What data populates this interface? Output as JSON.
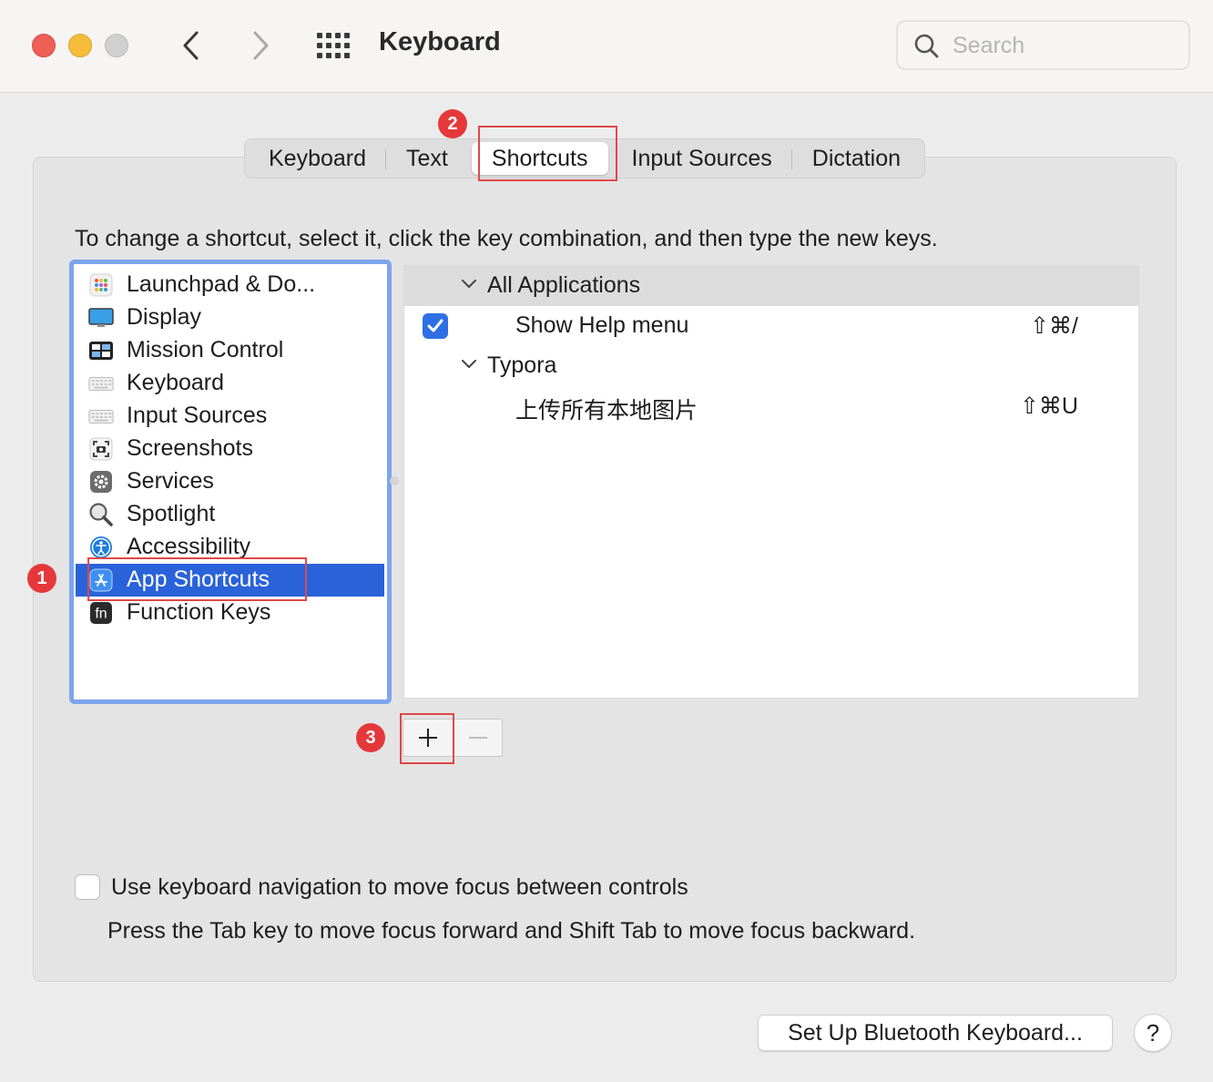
{
  "window": {
    "title": "Keyboard",
    "search_placeholder": "Search"
  },
  "tabs": [
    {
      "label": "Keyboard",
      "active": false
    },
    {
      "label": "Text",
      "active": false
    },
    {
      "label": "Shortcuts",
      "active": true
    },
    {
      "label": "Input Sources",
      "active": false
    },
    {
      "label": "Dictation",
      "active": false
    }
  ],
  "instruction": "To change a shortcut, select it, click the key combination, and then type the new keys.",
  "categories": [
    {
      "label": "Launchpad & Do...",
      "icon": "launchpad-icon"
    },
    {
      "label": "Display",
      "icon": "display-icon"
    },
    {
      "label": "Mission Control",
      "icon": "mission-control-icon"
    },
    {
      "label": "Keyboard",
      "icon": "keyboard-icon"
    },
    {
      "label": "Input Sources",
      "icon": "input-sources-icon"
    },
    {
      "label": "Screenshots",
      "icon": "screenshot-icon"
    },
    {
      "label": "Services",
      "icon": "gear-icon"
    },
    {
      "label": "Spotlight",
      "icon": "magnifier-icon"
    },
    {
      "label": "Accessibility",
      "icon": "accessibility-icon"
    },
    {
      "label": "App Shortcuts",
      "icon": "app-store-icon",
      "selected": true
    },
    {
      "label": "Function Keys",
      "icon": "fn-key-icon"
    }
  ],
  "shortcuts": {
    "groups": [
      {
        "name": "All Applications",
        "items": [
          {
            "label": "Show Help menu",
            "keys": "⇧⌘/",
            "checked": true
          }
        ]
      },
      {
        "name": "Typora",
        "items": [
          {
            "label": "上传所有本地图片",
            "keys": "⇧⌘U",
            "checked": false
          }
        ]
      }
    ]
  },
  "controls": {
    "add": "+",
    "remove": "—"
  },
  "annotations": {
    "badge1": "1",
    "badge2": "2",
    "badge3": "3"
  },
  "keyboard_navigation": {
    "checked": false,
    "label": "Use keyboard navigation to move focus between controls",
    "help": "Press the Tab key to move focus forward and Shift Tab to move focus backward."
  },
  "footer": {
    "bluetooth_button": "Set Up Bluetooth Keyboard...",
    "help_button": "?"
  },
  "colors": {
    "selection": "#2a62d9",
    "focus_ring": "#7da5ec",
    "annotation_red": "#e5383b",
    "checkbox_blue": "#2f6fe4"
  }
}
